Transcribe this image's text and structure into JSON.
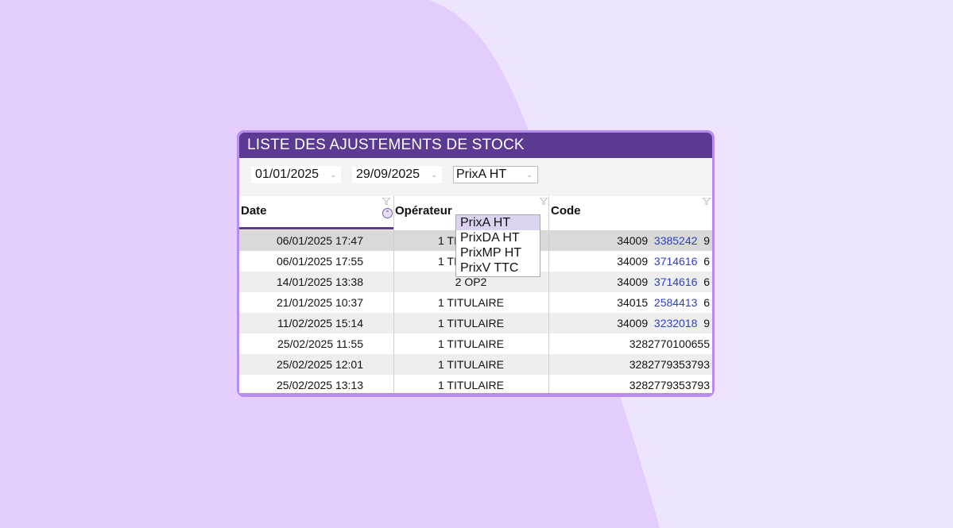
{
  "window": {
    "title": "LISTE DES AJUSTEMENTS DE STOCK"
  },
  "filters": {
    "date_from": "01/01/2025",
    "date_to": "29/09/2025",
    "price_type": "PrixA HT",
    "price_options": [
      "PrixA HT",
      "PrixDA HT",
      "PrixMP HT",
      "PrixV TTC"
    ]
  },
  "table": {
    "headers": {
      "date": "Date",
      "operator": "Opérateur",
      "code": "Code"
    },
    "rows": [
      {
        "date": "06/01/2025 17:47",
        "operator": "1 TITULAIRE",
        "code_a": "34009",
        "code_b": "3385242",
        "code_c": "9"
      },
      {
        "date": "06/01/2025 17:55",
        "operator": "1 TITULAIRE",
        "code_a": "34009",
        "code_b": "3714616",
        "code_c": "6"
      },
      {
        "date": "14/01/2025 13:38",
        "operator": "2 OP2",
        "code_a": "34009",
        "code_b": "3714616",
        "code_c": "6"
      },
      {
        "date": "21/01/2025 10:37",
        "operator": "1 TITULAIRE",
        "code_a": "34015",
        "code_b": "2584413",
        "code_c": "6"
      },
      {
        "date": "11/02/2025 15:14",
        "operator": "1 TITULAIRE",
        "code_a": "34009",
        "code_b": "3232018",
        "code_c": "9"
      },
      {
        "date": "25/02/2025 11:55",
        "operator": "1 TITULAIRE",
        "code_full": "3282770100655"
      },
      {
        "date": "25/02/2025 12:01",
        "operator": "1 TITULAIRE",
        "code_full": "3282779353793"
      },
      {
        "date": "25/02/2025 13:13",
        "operator": "1 TITULAIRE",
        "code_full": "3282779353793"
      }
    ]
  },
  "colors": {
    "title_bar": "#5b3a91",
    "frame": "#b98cf0",
    "code_link": "#2b3fd1",
    "background": "#efe4fd"
  }
}
